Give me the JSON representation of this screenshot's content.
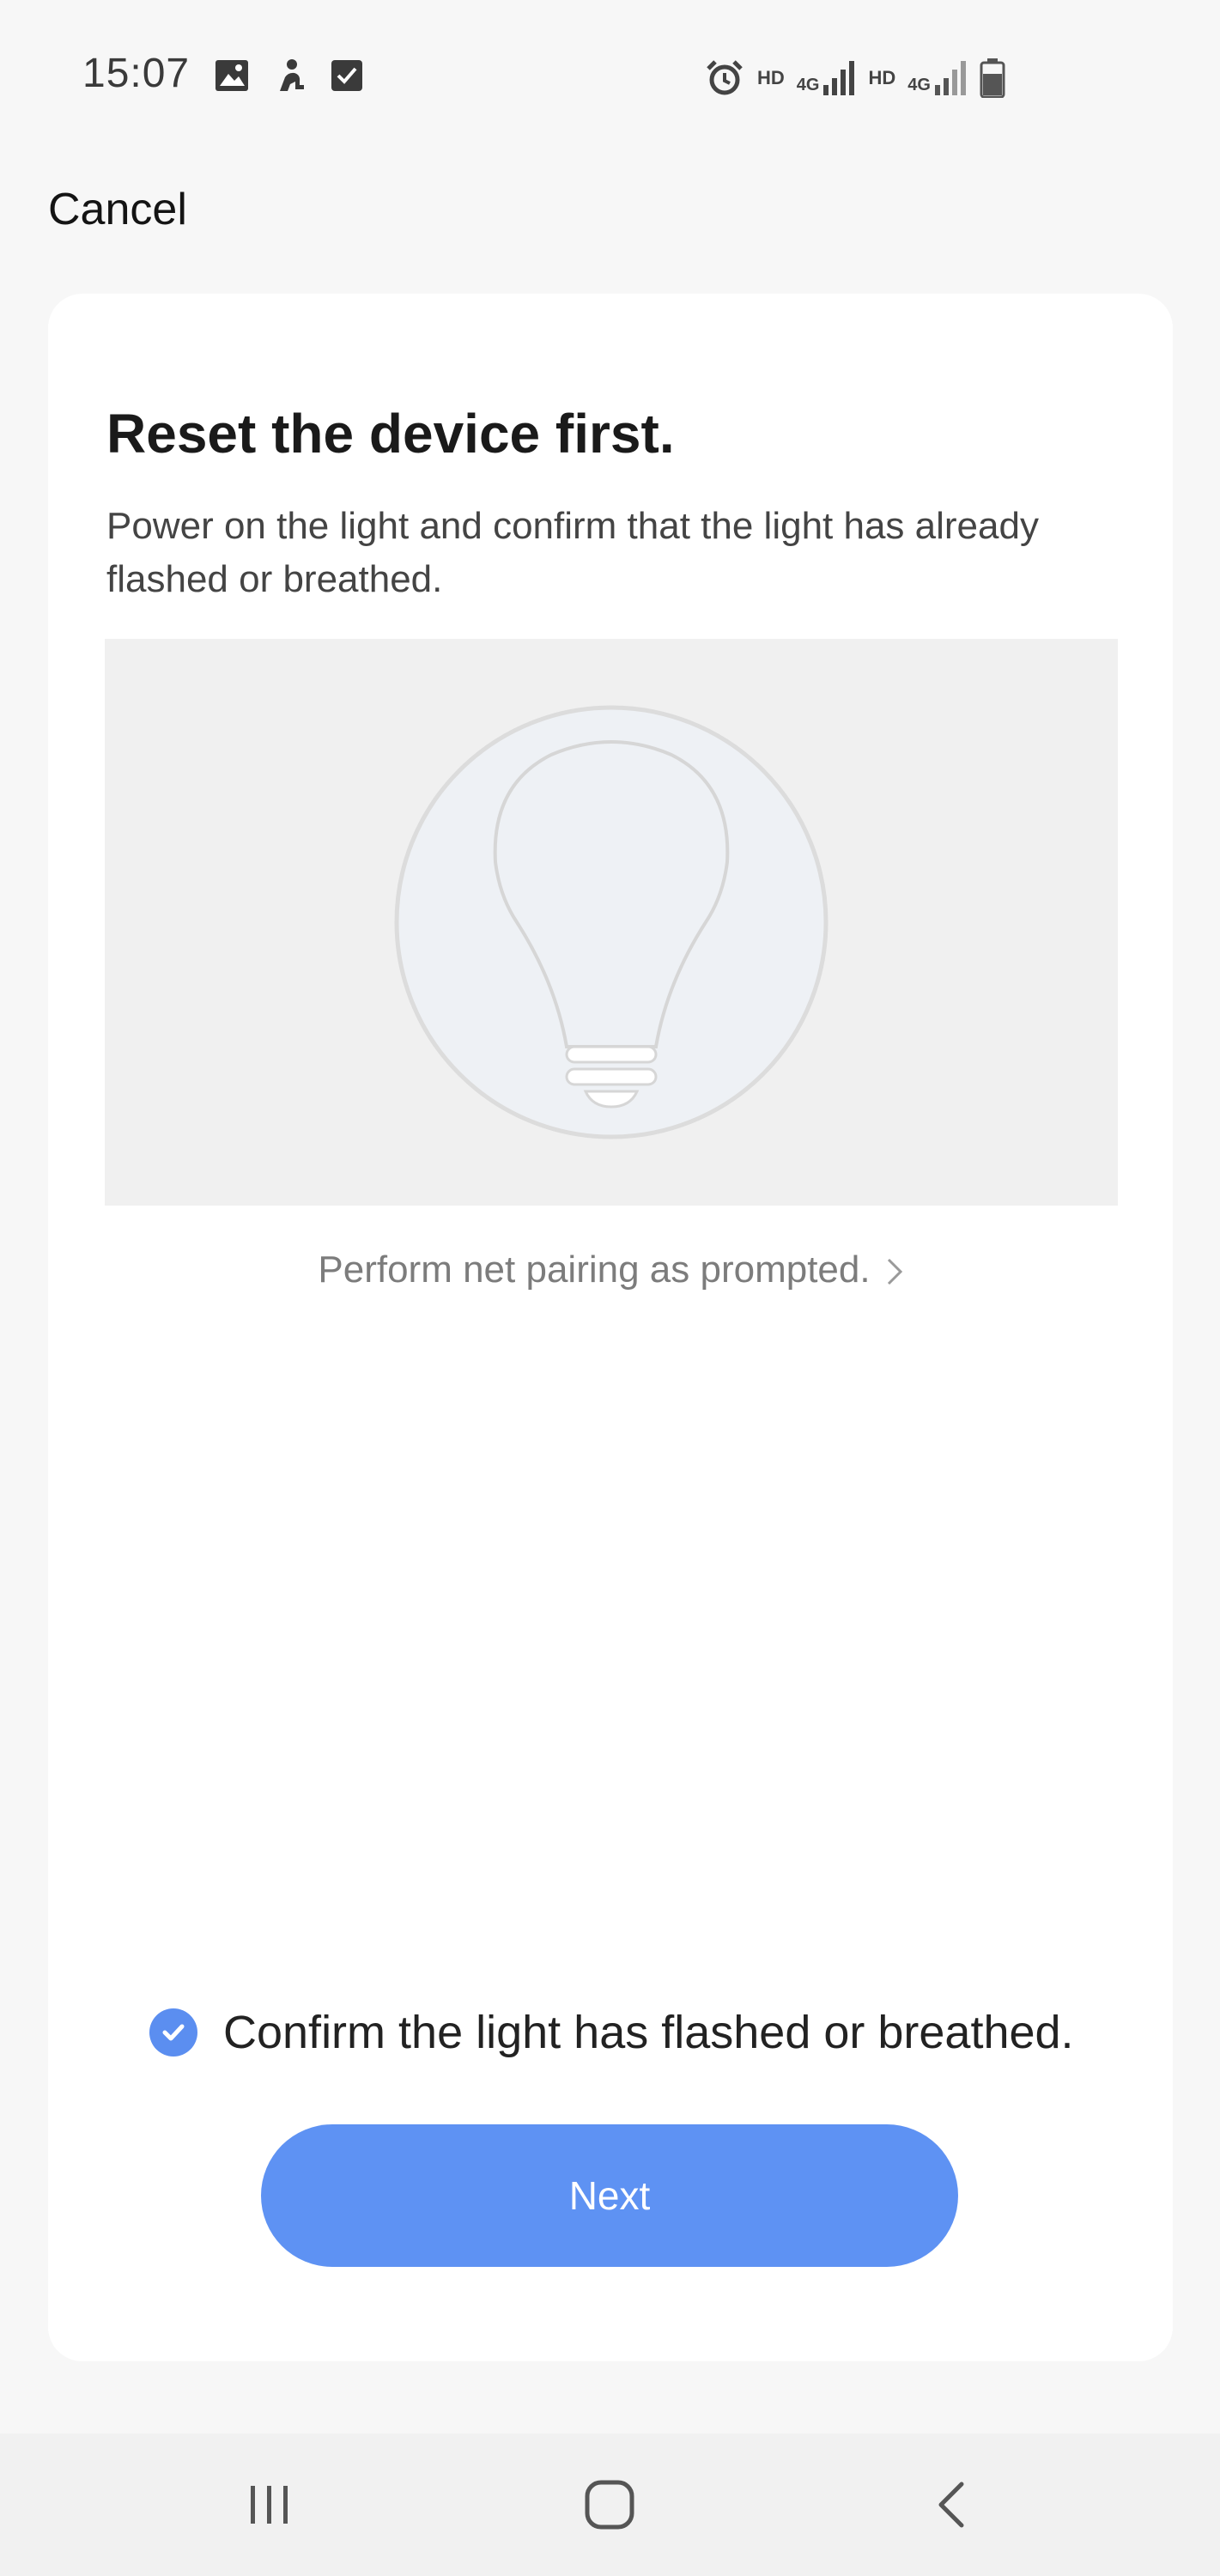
{
  "status_bar": {
    "time": "15:07",
    "left_icons": [
      "image-icon",
      "person-icon",
      "checkbox-icon"
    ],
    "right_icons": [
      "alarm-icon",
      "signal-4g-icon",
      "signal-4g-icon",
      "battery-icon"
    ],
    "hd_label_1": "HD",
    "net_label_1": "4G",
    "hd_label_2": "HD",
    "net_label_2": "4G"
  },
  "header": {
    "cancel_label": "Cancel"
  },
  "card": {
    "title": "Reset the device first.",
    "description": "Power on the light and confirm that the light has already flashed or breathed.",
    "illustration_icon": "light-bulb-icon",
    "prompt_link": "Perform net pairing as prompted.",
    "confirm_checked": true,
    "confirm_label": "Confirm the light has flashed or breathed.",
    "next_label": "Next"
  },
  "nav_bar": {
    "icons": [
      "recents-icon",
      "home-icon",
      "back-icon"
    ]
  },
  "colors": {
    "accent": "#5e92f3",
    "background": "#f7f7f7",
    "card": "#ffffff",
    "illustration_bg": "#f0f0f0"
  }
}
